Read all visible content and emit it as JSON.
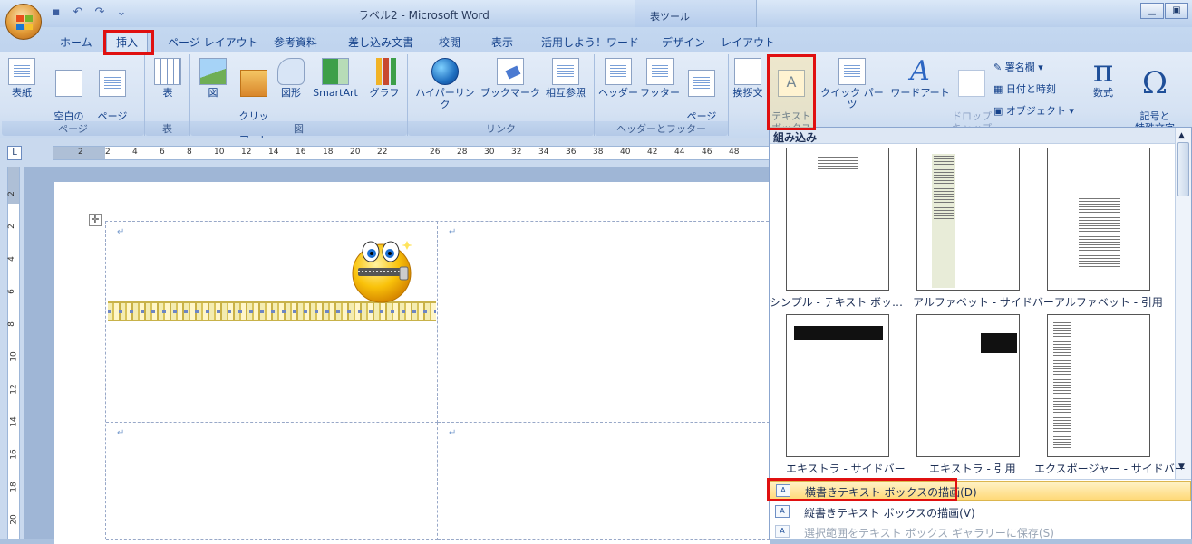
{
  "title_bar": {
    "title": "ラベル2 - Microsoft Word",
    "context_tab_title": "表ツール"
  },
  "tabs": [
    "ホーム",
    "挿入",
    "ページ レイアウト",
    "参考資料",
    "差し込み文書",
    "校閲",
    "表示",
    "活用しよう！ワード",
    "デザイン",
    "レイアウト"
  ],
  "ribbon": {
    "pages": {
      "cover": "表紙",
      "blank_page": "空白の\nページ",
      "page_break": "ページ\n区切り",
      "label": "ページ"
    },
    "tables": {
      "table": "表",
      "label": "表"
    },
    "illustrations": {
      "picture": "図",
      "clipart": "クリップ\nアート",
      "shapes": "図形",
      "smartart": "SmartArt",
      "chart": "グラフ",
      "label": "図"
    },
    "links": {
      "hyperlink": "ハイパーリンク",
      "bookmark": "ブックマーク",
      "crossref": "相互参照",
      "label": "リンク"
    },
    "header_footer": {
      "header": "ヘッダー",
      "footer": "フッター",
      "page_number": "ページ\n番号",
      "label": "ヘッダーとフッター"
    },
    "text": {
      "greeting": "挨拶文",
      "textbox": "テキスト\nボックス",
      "quickparts": "クイック パーツ",
      "wordart": "ワードアート",
      "dropcap": "ドロップ\nキャップ",
      "signature": "署名欄",
      "datetime": "日付と時刻",
      "object": "オブジェクト"
    },
    "symbols": {
      "equation": "数式",
      "symbol": "記号と\n特殊文字"
    }
  },
  "ruler": {
    "h_ticks": [
      "2",
      "2",
      "4",
      "6",
      "8",
      "10",
      "12",
      "14",
      "16",
      "18",
      "20",
      "22",
      "26",
      "28",
      "30",
      "32",
      "34",
      "36",
      "38",
      "40",
      "42",
      "44",
      "46",
      "48"
    ],
    "v_ticks": [
      "2",
      "2",
      "4",
      "6",
      "8",
      "10",
      "12",
      "14",
      "16",
      "18",
      "20"
    ]
  },
  "gallery": {
    "header": "組み込み",
    "items": [
      {
        "label": "シンプル - テキスト ボッ…"
      },
      {
        "label": "アルファベット - サイドバー"
      },
      {
        "label": "アルファベット - 引用"
      },
      {
        "label": "エキストラ - サイドバー"
      },
      {
        "label": "エキストラ - 引用"
      },
      {
        "label": "エクスポージャー - サイドバー"
      }
    ],
    "menu": [
      {
        "label": "横書きテキスト ボックスの描画(D)",
        "state": "active"
      },
      {
        "label": "縦書きテキスト ボックスの描画(V)",
        "state": "normal"
      },
      {
        "label": "選択範囲をテキスト ボックス ギャラリーに保存(S)",
        "state": "disabled"
      }
    ]
  },
  "colors": {
    "highlight": "#e01010",
    "accent": "#15428b"
  }
}
